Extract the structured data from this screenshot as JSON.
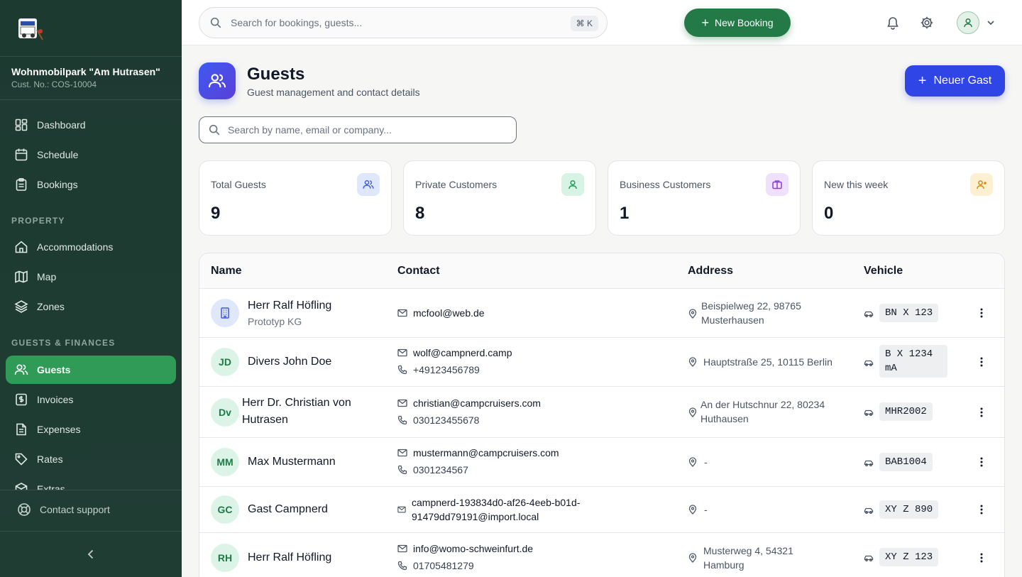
{
  "org": {
    "name": "Wohnmobilpark \"Am Hutrasen\"",
    "customer_no": "Cust. No.: COS-10004"
  },
  "nav": {
    "main": [
      {
        "label": "Dashboard",
        "icon": "dashboard-icon"
      },
      {
        "label": "Schedule",
        "icon": "calendar-icon"
      },
      {
        "label": "Bookings",
        "icon": "clipboard-icon"
      }
    ],
    "property_label": "PROPERTY",
    "property": [
      {
        "label": "Accommodations",
        "icon": "home-icon"
      },
      {
        "label": "Map",
        "icon": "map-icon"
      },
      {
        "label": "Zones",
        "icon": "layers-icon"
      }
    ],
    "finances_label": "GUESTS & FINANCES",
    "finances": [
      {
        "label": "Guests",
        "icon": "users-icon",
        "active": true
      },
      {
        "label": "Invoices",
        "icon": "invoice-icon"
      },
      {
        "label": "Expenses",
        "icon": "file-icon"
      },
      {
        "label": "Rates",
        "icon": "tag-icon"
      },
      {
        "label": "Extras",
        "icon": "box-icon"
      }
    ],
    "support": "Contact support"
  },
  "topbar": {
    "search_placeholder": "Search for bookings, guests...",
    "shortcut": "⌘ K",
    "new_booking": "New Booking"
  },
  "page": {
    "title": "Guests",
    "subtitle": "Guest management and contact details",
    "new_guest": "Neuer Gast",
    "search_placeholder": "Search by name, email or company..."
  },
  "stats": [
    {
      "label": "Total Guests",
      "value": "9",
      "icon": "users-icon",
      "bg": "#dfe7fb",
      "fg": "#3d5af1"
    },
    {
      "label": "Private Customers",
      "value": "8",
      "icon": "user-icon",
      "bg": "#d6f3e3",
      "fg": "#1f9a57"
    },
    {
      "label": "Business Customers",
      "value": "1",
      "icon": "briefcase-icon",
      "bg": "#efe0fb",
      "fg": "#8b3fd9"
    },
    {
      "label": "New this week",
      "value": "0",
      "icon": "user-plus-icon",
      "bg": "#fcefd2",
      "fg": "#d98a0b"
    }
  ],
  "table": {
    "headers": {
      "name": "Name",
      "contact": "Contact",
      "address": "Address",
      "vehicle": "Vehicle"
    },
    "rows": [
      {
        "initials": "",
        "type": "business",
        "name": "Herr Ralf Höfling",
        "company": "Prototyp KG",
        "email": "mcfool@web.de",
        "phone": "",
        "address1": "Beispielweg 22, 98765",
        "address2": "Musterhausen",
        "plate": "BN X 123"
      },
      {
        "initials": "JD",
        "type": "private",
        "name": "Divers John Doe",
        "company": "",
        "email": "wolf@campnerd.camp",
        "phone": "+49123456789",
        "address1": "Hauptstraße 25, 10115 Berlin",
        "address2": "",
        "plate": "B X 1234\nmA"
      },
      {
        "initials": "Dv",
        "type": "private",
        "name": "Herr Dr. Christian von Hutrasen",
        "company": "",
        "email": "christian@campcruisers.com",
        "phone": "030123455678",
        "address1": "An der Hutschnur 22, 80234",
        "address2": "Huthausen",
        "plate": "MHR2002"
      },
      {
        "initials": "MM",
        "type": "private",
        "name": "Max Mustermann",
        "company": "",
        "email": "mustermann@campcruisers.com",
        "phone": "0301234567",
        "address1": "-",
        "address2": "",
        "plate": "BAB1004"
      },
      {
        "initials": "GC",
        "type": "private",
        "name": "Gast Campnerd",
        "company": "",
        "email": "campnerd-193834d0-af26-4eeb-b01d-\n91479dd79191@import.local",
        "phone": "",
        "address1": "-",
        "address2": "",
        "plate": "XY Z 890"
      },
      {
        "initials": "RH",
        "type": "private",
        "name": "Herr Ralf Höfling",
        "company": "",
        "email": "info@womo-schweinfurt.de",
        "phone": "01705481279",
        "address1": "Musterweg 4, 54321",
        "address2": "Hamburg",
        "plate": "XY Z 123"
      }
    ]
  }
}
